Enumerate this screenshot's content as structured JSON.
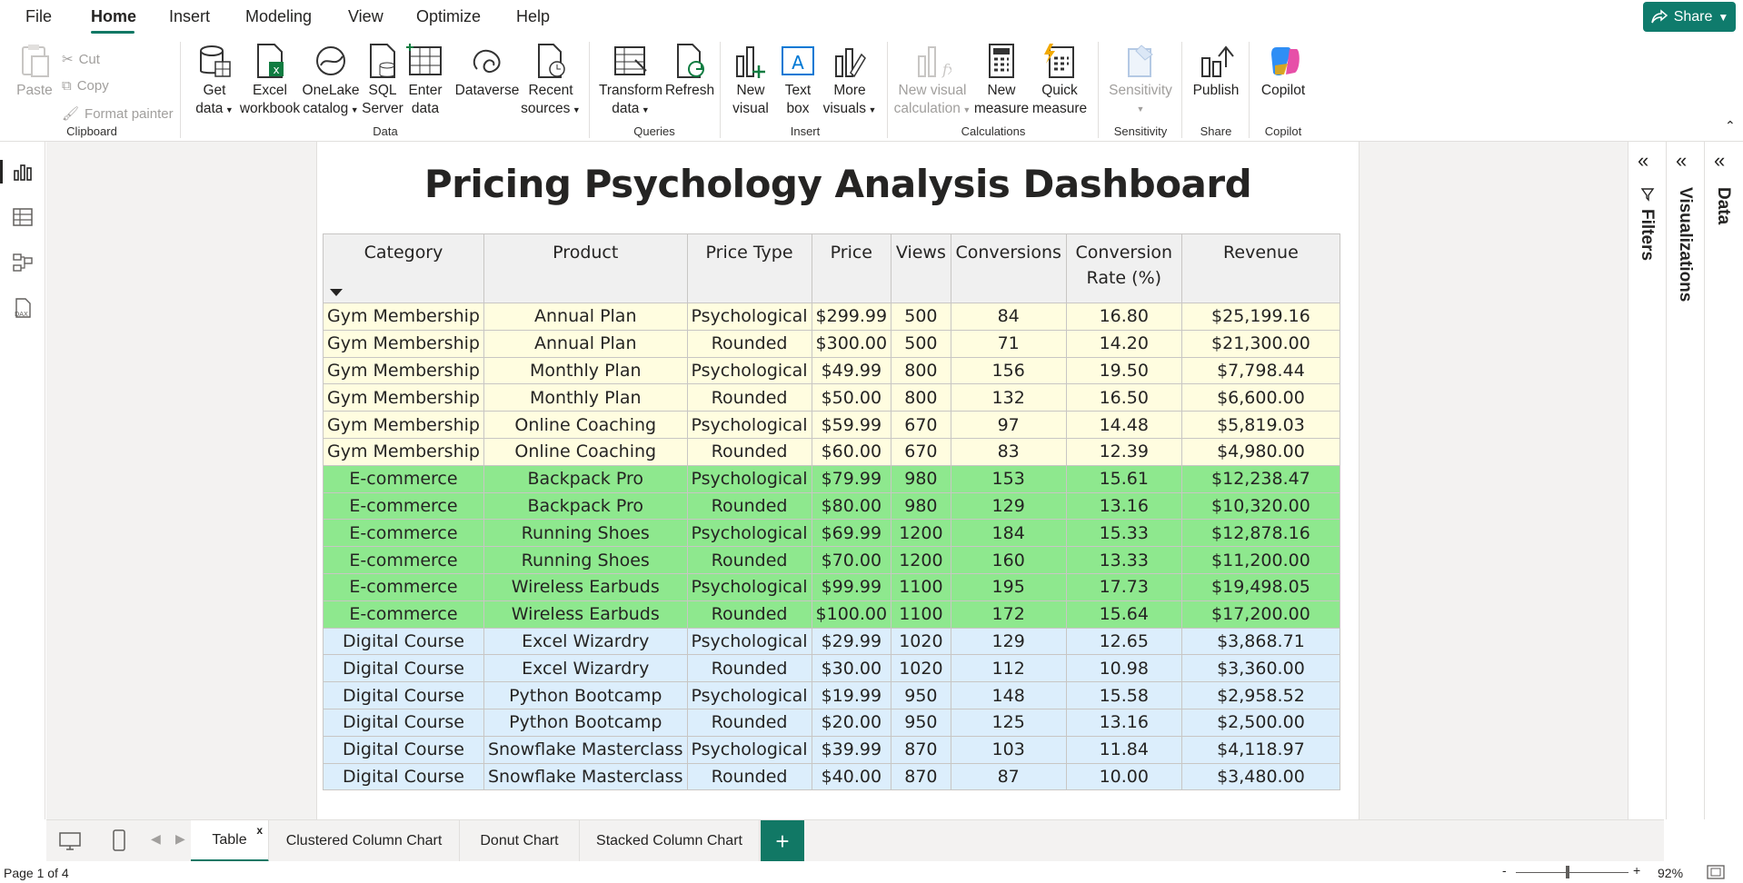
{
  "menu": {
    "file": "File",
    "home": "Home",
    "insert": "Insert",
    "modeling": "Modeling",
    "view": "View",
    "optimize": "Optimize",
    "help": "Help",
    "share": "Share"
  },
  "ribbon": {
    "clipboard": {
      "paste": "Paste",
      "cut": "Cut",
      "copy": "Copy",
      "format_painter": "Format painter",
      "label": "Clipboard"
    },
    "data": {
      "get_data_1": "Get",
      "get_data_2": "data",
      "excel_1": "Excel",
      "excel_2": "workbook",
      "onelake_1": "OneLake",
      "onelake_2": "catalog",
      "sql_1": "SQL",
      "sql_2": "Server",
      "enter_1": "Enter",
      "enter_2": "data",
      "dataverse": "Dataverse",
      "recent_1": "Recent",
      "recent_2": "sources",
      "label": "Data"
    },
    "queries": {
      "transform_1": "Transform",
      "transform_2": "data",
      "refresh": "Refresh",
      "label": "Queries"
    },
    "insert": {
      "newvisual_1": "New",
      "newvisual_2": "visual",
      "textbox_1": "Text",
      "textbox_2": "box",
      "more_1": "More",
      "more_2": "visuals",
      "label": "Insert"
    },
    "calculations": {
      "nvc_1": "New visual",
      "nvc_2": "calculation",
      "nm_1": "New",
      "nm_2": "measure",
      "qm_1": "Quick",
      "qm_2": "measure",
      "label": "Calculations"
    },
    "sensitivity": {
      "btn": "Sensitivity",
      "label": "Sensitivity"
    },
    "share": {
      "publish": "Publish",
      "label": "Share"
    },
    "copilot": {
      "btn": "Copilot",
      "label": "Copilot"
    }
  },
  "report": {
    "title": "Pricing Psychology Analysis Dashboard",
    "columns": [
      "Category",
      "Product",
      "Price Type",
      "Price",
      "Views",
      "Conversions",
      "Conversion Rate (%)",
      "Revenue"
    ],
    "rows": [
      {
        "g": "gym",
        "c": [
          "Gym Membership",
          "Annual Plan",
          "Psychological",
          "$299.99",
          "500",
          "84",
          "16.80",
          "$25,199.16"
        ]
      },
      {
        "g": "gym",
        "c": [
          "Gym Membership",
          "Annual Plan",
          "Rounded",
          "$300.00",
          "500",
          "71",
          "14.20",
          "$21,300.00"
        ]
      },
      {
        "g": "gym",
        "c": [
          "Gym Membership",
          "Monthly Plan",
          "Psychological",
          "$49.99",
          "800",
          "156",
          "19.50",
          "$7,798.44"
        ]
      },
      {
        "g": "gym",
        "c": [
          "Gym Membership",
          "Monthly Plan",
          "Rounded",
          "$50.00",
          "800",
          "132",
          "16.50",
          "$6,600.00"
        ]
      },
      {
        "g": "gym",
        "c": [
          "Gym Membership",
          "Online Coaching",
          "Psychological",
          "$59.99",
          "670",
          "97",
          "14.48",
          "$5,819.03"
        ]
      },
      {
        "g": "gym",
        "c": [
          "Gym Membership",
          "Online Coaching",
          "Rounded",
          "$60.00",
          "670",
          "83",
          "12.39",
          "$4,980.00"
        ]
      },
      {
        "g": "ec",
        "c": [
          "E-commerce",
          "Backpack Pro",
          "Psychological",
          "$79.99",
          "980",
          "153",
          "15.61",
          "$12,238.47"
        ]
      },
      {
        "g": "ec",
        "c": [
          "E-commerce",
          "Backpack Pro",
          "Rounded",
          "$80.00",
          "980",
          "129",
          "13.16",
          "$10,320.00"
        ]
      },
      {
        "g": "ec",
        "c": [
          "E-commerce",
          "Running Shoes",
          "Psychological",
          "$69.99",
          "1200",
          "184",
          "15.33",
          "$12,878.16"
        ]
      },
      {
        "g": "ec",
        "c": [
          "E-commerce",
          "Running Shoes",
          "Rounded",
          "$70.00",
          "1200",
          "160",
          "13.33",
          "$11,200.00"
        ]
      },
      {
        "g": "ec",
        "c": [
          "E-commerce",
          "Wireless Earbuds",
          "Psychological",
          "$99.99",
          "1100",
          "195",
          "17.73",
          "$19,498.05"
        ]
      },
      {
        "g": "ec",
        "c": [
          "E-commerce",
          "Wireless Earbuds",
          "Rounded",
          "$100.00",
          "1100",
          "172",
          "15.64",
          "$17,200.00"
        ]
      },
      {
        "g": "dc",
        "c": [
          "Digital Course",
          "Excel Wizardry",
          "Psychological",
          "$29.99",
          "1020",
          "129",
          "12.65",
          "$3,868.71"
        ]
      },
      {
        "g": "dc",
        "c": [
          "Digital Course",
          "Excel Wizardry",
          "Rounded",
          "$30.00",
          "1020",
          "112",
          "10.98",
          "$3,360.00"
        ]
      },
      {
        "g": "dc",
        "c": [
          "Digital Course",
          "Python Bootcamp",
          "Psychological",
          "$19.99",
          "950",
          "148",
          "15.58",
          "$2,958.52"
        ]
      },
      {
        "g": "dc",
        "c": [
          "Digital Course",
          "Python Bootcamp",
          "Rounded",
          "$20.00",
          "950",
          "125",
          "13.16",
          "$2,500.00"
        ]
      },
      {
        "g": "dc",
        "c": [
          "Digital Course",
          "Snowflake Masterclass",
          "Psychological",
          "$39.99",
          "870",
          "103",
          "11.84",
          "$4,118.97"
        ]
      },
      {
        "g": "dc",
        "c": [
          "Digital Course",
          "Snowflake Masterclass",
          "Rounded",
          "$40.00",
          "870",
          "87",
          "10.00",
          "$3,480.00"
        ]
      }
    ]
  },
  "panels": {
    "filters": "Filters",
    "visualizations": "Visualizations",
    "data": "Data"
  },
  "tabs": {
    "t1": "Table",
    "t2": "Clustered Column Chart",
    "t3": "Donut Chart",
    "t4": "Stacked Column Chart",
    "add": "+",
    "close": "x"
  },
  "status": {
    "page": "Page 1 of 4",
    "zoom": "92%"
  },
  "colors": {
    "accent": "#117865",
    "gym_row": "#fffde0",
    "ecommerce_row": "#8ee88e",
    "course_row": "#dceefc"
  }
}
